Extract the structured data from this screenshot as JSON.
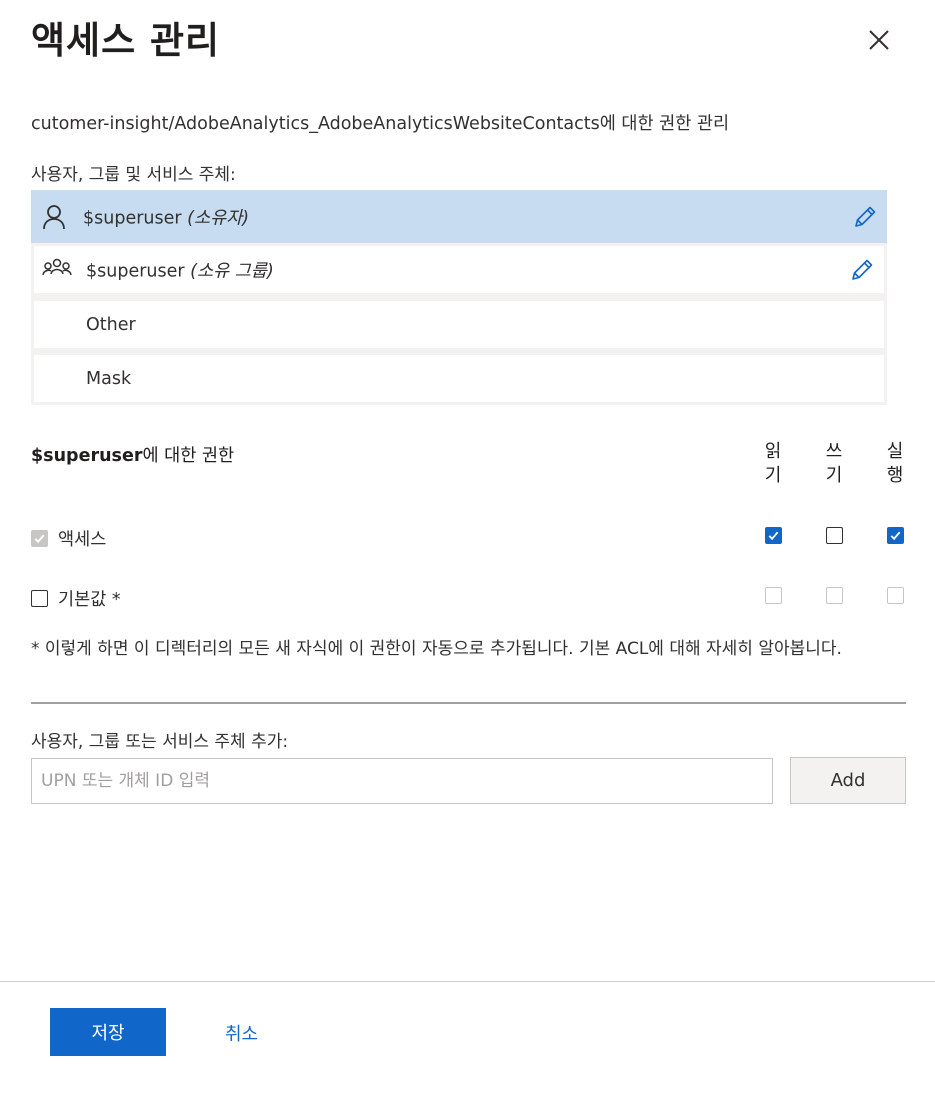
{
  "panel": {
    "title": "액세스 관리",
    "subtitle": "cutomer-insight/AdobeAnalytics_AdobeAnalyticsWebsiteContacts에 대한 권한 관리",
    "principals_label": "사용자, 그룹 및 서비스 주체:"
  },
  "principals": [
    {
      "icon": "user-icon",
      "name": "$superuser",
      "role": "(소유자)",
      "editable": true,
      "selected": true
    },
    {
      "icon": "group-icon",
      "name": "$superuser",
      "role": "(소유 그룹)",
      "editable": true,
      "selected": false
    },
    {
      "name": "Other"
    },
    {
      "name": "Mask"
    }
  ],
  "permissions": {
    "principal_name": "$superuser",
    "title_suffix": "에 대한 권한",
    "columns": [
      {
        "line1": "읽",
        "line2": "기"
      },
      {
        "line1": "쓰",
        "line2": "기"
      },
      {
        "line1": "실",
        "line2": "행"
      }
    ],
    "rows": [
      {
        "label": "액세스",
        "enabled_checked": true,
        "enabled_disabled": true,
        "values": [
          true,
          false,
          true
        ],
        "values_disabled": false
      },
      {
        "label": "기본값 *",
        "enabled_checked": false,
        "enabled_disabled": false,
        "values": [
          false,
          false,
          false
        ],
        "values_disabled": true
      }
    ],
    "note": "* 이렇게 하면 이 디렉터리의 모든 새 자식에 이 권한이 자동으로 추가됩니다. 기본 ACL에 대해 자세히 알아봅니다."
  },
  "add": {
    "label": "사용자, 그룹 또는 서비스 주체 추가:",
    "placeholder": "UPN 또는 개체 ID 입력",
    "value": "",
    "button": "Add"
  },
  "footer": {
    "save": "저장",
    "cancel": "취소"
  },
  "colors": {
    "accent": "#1167c9",
    "selected_row": "#c7dcf1",
    "list_background": "#f3f2f1"
  }
}
